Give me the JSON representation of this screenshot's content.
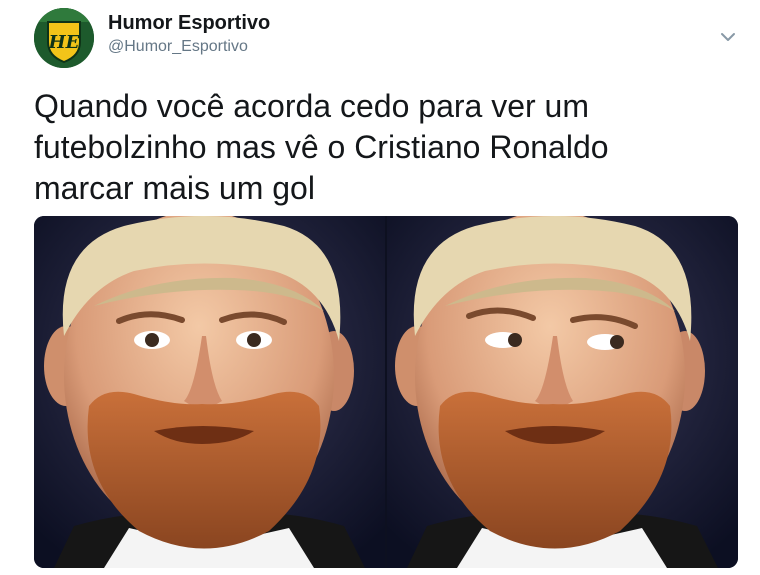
{
  "author": {
    "display_name": "Humor Esportivo",
    "handle": "@Humor_Esportivo",
    "avatar_initials": "HE"
  },
  "tweet": {
    "text_lines": [
      "Quando você acorda cedo para ver um",
      "futebolzinho mas vê o Cristiano Ronaldo",
      "marcar mais um gol"
    ]
  },
  "media": {
    "photos": [
      {
        "name": "photo-left-straight-face",
        "subject": "bearded player looking forward"
      },
      {
        "name": "photo-right-side-eye",
        "subject": "bearded player glancing sideways"
      }
    ]
  },
  "icons": {
    "more": "chevron-down-icon"
  },
  "colors": {
    "name": "#14171a",
    "handle": "#657786",
    "avatar_green": "#1d5a2c",
    "avatar_yellow": "#f2c419"
  }
}
